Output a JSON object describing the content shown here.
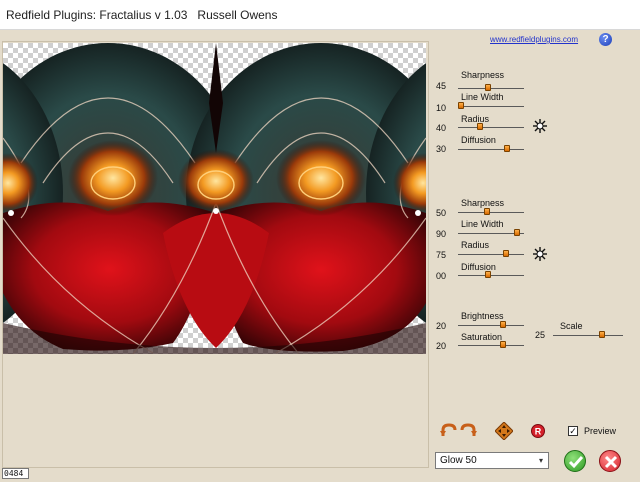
{
  "window": {
    "title": "Redfield Plugins: Fractalius v 1.03   Russell Owens"
  },
  "header": {
    "link_text": "www.redfieldplugins.com",
    "help_label": "?"
  },
  "status": {
    "value": "0484"
  },
  "group1": {
    "sharpness": {
      "label": "Sharpness",
      "value": "45",
      "level": 0.45
    },
    "line_width": {
      "label": "Line Width",
      "value": "10",
      "level": 0.05
    },
    "radius": {
      "label": "Radius",
      "value": "40",
      "level": 0.33
    },
    "diffusion": {
      "label": "Diffusion",
      "value": "30",
      "level": 0.74
    }
  },
  "group2": {
    "sharpness": {
      "label": "Sharpness",
      "value": "50",
      "level": 0.44
    },
    "line_width": {
      "label": "Line Width",
      "value": "90",
      "level": 0.9
    },
    "radius": {
      "label": "Radius",
      "value": "75",
      "level": 0.72
    },
    "diffusion": {
      "label": "Diffusion",
      "value": "00",
      "level": 0.45
    }
  },
  "group3": {
    "brightness": {
      "label": "Brightness",
      "value": "20",
      "level": 0.68
    },
    "saturation": {
      "label": "Saturation",
      "value": "20",
      "level": 0.68
    },
    "scale": {
      "label": "Scale",
      "value": "25",
      "level": 0.7
    }
  },
  "footer": {
    "preview_label": "Preview",
    "preview_checked": "✓",
    "preset_value": "Glow 50",
    "dropdown_arrow": "▾"
  },
  "icons": {
    "sun_icon": "randomize-sun-icon",
    "undo_icon": "undo-arrow-icon",
    "redo_icon": "redo-arrow-icon",
    "compass_icon": "move-diamond-icon",
    "reset_icon": "reset-r-icon"
  },
  "colors": {
    "accent_orange": "#e07a10",
    "ok_green": "#2d9a22",
    "cancel_red": "#d4202a",
    "link_blue": "#2233cc"
  }
}
